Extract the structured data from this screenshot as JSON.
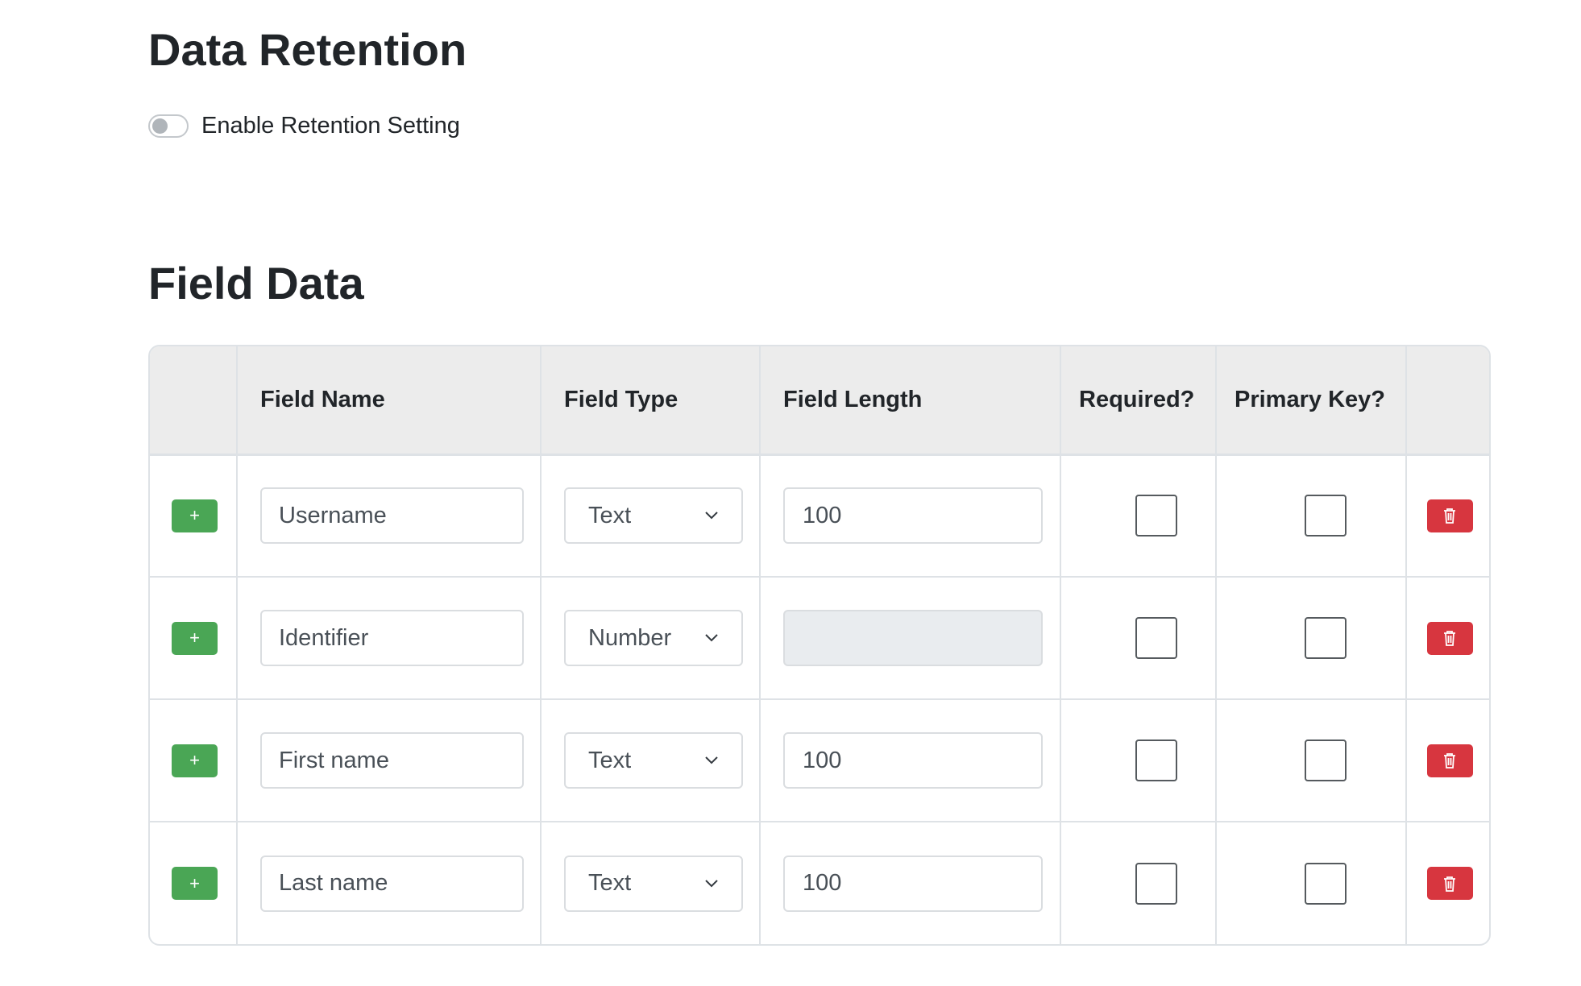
{
  "retention": {
    "title": "Data Retention",
    "toggle_label": "Enable Retention Setting",
    "enabled": false
  },
  "field_data": {
    "title": "Field Data",
    "columns": [
      "",
      "Field Name",
      "Field Type",
      "Field Length",
      "Required?",
      "Primary Key?",
      ""
    ],
    "rows": [
      {
        "add_label": "+",
        "name": "Username",
        "type": "Text",
        "length": "100",
        "length_disabled": false,
        "required": false,
        "primary_key": false
      },
      {
        "add_label": "+",
        "name": "Identifier",
        "type": "Number",
        "length": "",
        "length_disabled": true,
        "required": false,
        "primary_key": false
      },
      {
        "add_label": "+",
        "name": "First name",
        "type": "Text",
        "length": "100",
        "length_disabled": false,
        "required": false,
        "primary_key": false
      },
      {
        "add_label": "+",
        "name": "Last name",
        "type": "Text",
        "length": "100",
        "length_disabled": false,
        "required": false,
        "primary_key": false
      }
    ]
  },
  "icons": {
    "add": "plus-icon",
    "delete": "trash-icon",
    "select": "chevron-down-icon"
  },
  "colors": {
    "add_button": "#4aa655",
    "delete_button": "#d7363f",
    "header_bg": "#ececec"
  }
}
